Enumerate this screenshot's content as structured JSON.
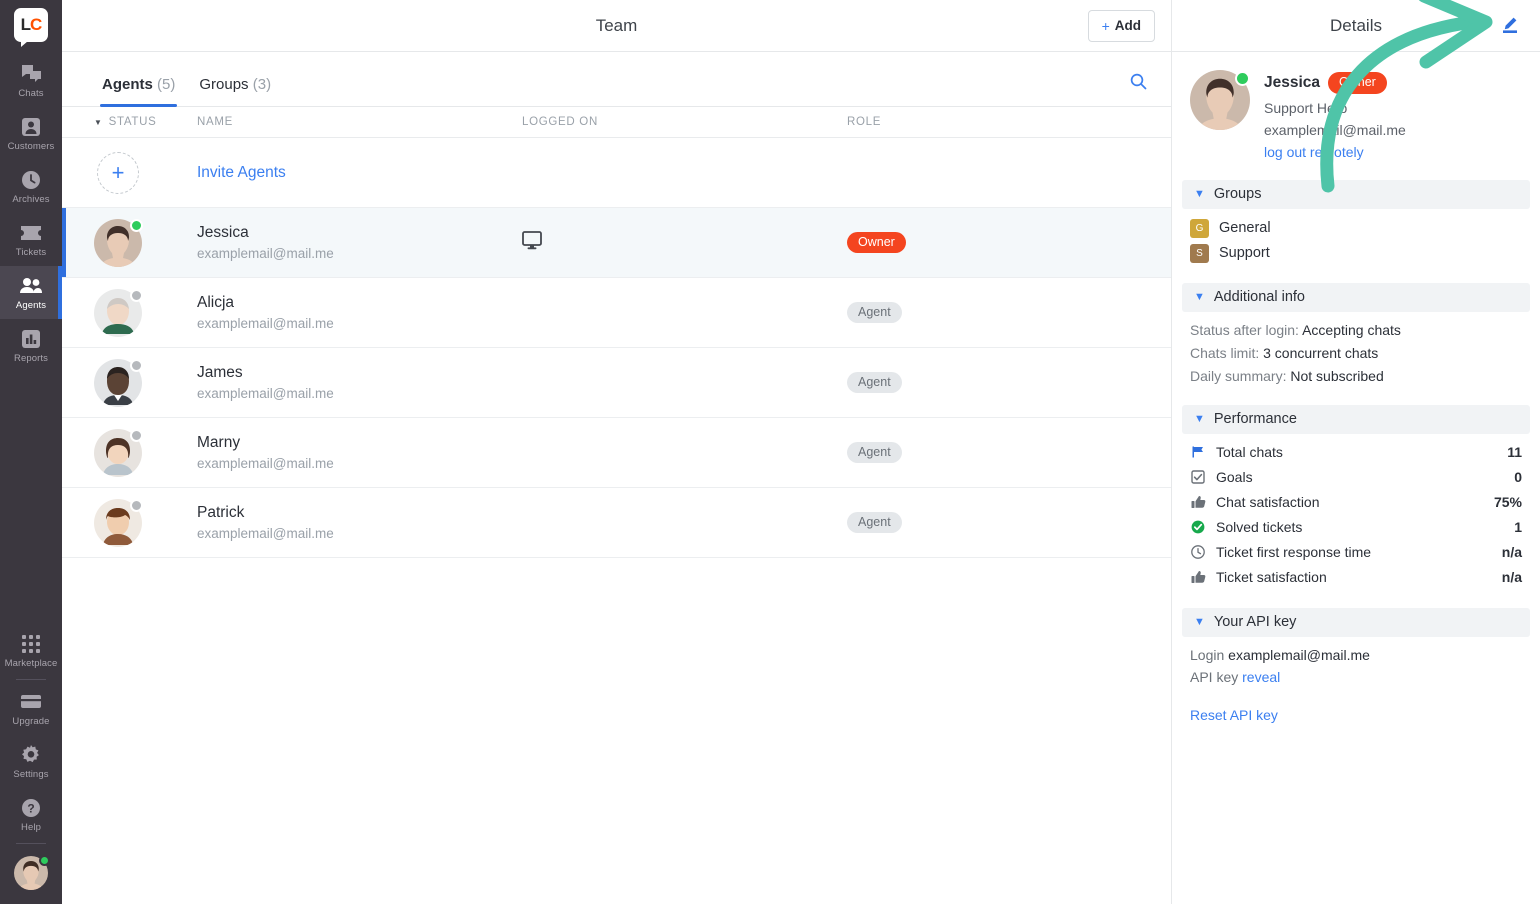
{
  "nav": {
    "logo": {
      "left": "L",
      "right": "C",
      "name": "livechat-logo"
    },
    "items": [
      {
        "label": "Chats",
        "icon": "chats-icon",
        "active": false
      },
      {
        "label": "Customers",
        "icon": "customers-icon",
        "active": false
      },
      {
        "label": "Archives",
        "icon": "archives-icon",
        "active": false
      },
      {
        "label": "Tickets",
        "icon": "tickets-icon",
        "active": false
      },
      {
        "label": "Agents",
        "icon": "agents-icon",
        "active": true
      },
      {
        "label": "Reports",
        "icon": "reports-icon",
        "active": false
      }
    ],
    "bottom_items": [
      {
        "label": "Marketplace",
        "icon": "marketplace-icon"
      },
      {
        "label": "Upgrade",
        "icon": "upgrade-icon"
      },
      {
        "label": "Settings",
        "icon": "gear-icon"
      },
      {
        "label": "Help",
        "icon": "help-icon"
      }
    ],
    "account_status": "online"
  },
  "header": {
    "title": "Team",
    "add_button": {
      "plus": "+",
      "label": "Add"
    }
  },
  "tabs": [
    {
      "label": "Agents",
      "count": "(5)",
      "active": true
    },
    {
      "label": "Groups",
      "count": "(3)",
      "active": false
    }
  ],
  "search": {
    "icon": "search-icon"
  },
  "table": {
    "columns": {
      "status": "STATUS",
      "name": "NAME",
      "logged_on": "LOGGED ON",
      "role": "ROLE"
    },
    "invite_row": {
      "label": "Invite Agents",
      "plus": "+"
    },
    "rows": [
      {
        "name": "Jessica",
        "email": "examplemail@mail.me",
        "status": "online",
        "logged_on": "desktop-icon",
        "role": "Owner",
        "role_kind": "owner",
        "selected": true
      },
      {
        "name": "Alicja",
        "email": "examplemail@mail.me",
        "status": "offline",
        "logged_on": "",
        "role": "Agent",
        "role_kind": "agent",
        "selected": false
      },
      {
        "name": "James",
        "email": "examplemail@mail.me",
        "status": "offline",
        "logged_on": "",
        "role": "Agent",
        "role_kind": "agent",
        "selected": false
      },
      {
        "name": "Marny",
        "email": "examplemail@mail.me",
        "status": "offline",
        "logged_on": "",
        "role": "Agent",
        "role_kind": "agent",
        "selected": false
      },
      {
        "name": "Patrick",
        "email": "examplemail@mail.me",
        "status": "offline",
        "logged_on": "",
        "role": "Agent",
        "role_kind": "agent",
        "selected": false
      }
    ]
  },
  "details": {
    "title": "Details",
    "edit_icon": "edit-pencil-icon",
    "profile": {
      "name": "Jessica",
      "badge": "Owner",
      "job_title": "Support Hero",
      "email": "examplemail@mail.me",
      "logout_link": "log out remotely",
      "status": "online"
    },
    "groups_section": {
      "title": "Groups",
      "items": [
        {
          "initial": "G",
          "name": "General",
          "color": "#cfa73a"
        },
        {
          "initial": "S",
          "name": "Support",
          "color": "#a07a4e"
        }
      ]
    },
    "additional_info": {
      "title": "Additional info",
      "rows": [
        {
          "key": "Status after login:",
          "value": "Accepting chats"
        },
        {
          "key": "Chats limit:",
          "value": "3 concurrent chats"
        },
        {
          "key": "Daily summary:",
          "value": "Not subscribed"
        }
      ]
    },
    "performance": {
      "title": "Performance",
      "rows": [
        {
          "icon": "flag-icon",
          "label": "Total chats",
          "value": "11"
        },
        {
          "icon": "checkbox-icon",
          "label": "Goals",
          "value": "0"
        },
        {
          "icon": "thumbs-up-icon",
          "label": "Chat satisfaction",
          "value": "75%"
        },
        {
          "icon": "check-circle-icon",
          "label": "Solved tickets",
          "value": "1"
        },
        {
          "icon": "clock-icon",
          "label": "Ticket first response time",
          "value": "n/a"
        },
        {
          "icon": "thumbs-up-icon",
          "label": "Ticket satisfaction",
          "value": "n/a"
        }
      ]
    },
    "api_key": {
      "title": "Your API key",
      "login_label": "Login",
      "login_value": "examplemail@mail.me",
      "api_key_label": "API key",
      "reveal_link": "reveal",
      "reset_link": "Reset API key"
    }
  },
  "annotation": {
    "type": "curved-arrow",
    "color": "#4fc4a8",
    "points_to": "edit-pencil-icon"
  },
  "colors": {
    "accent_blue": "#2f6fde",
    "link_blue": "#3b7ff0",
    "owner_red": "#f4451f",
    "online_green": "#2ecc5d",
    "offline_gray": "#b6b9bd",
    "nav_bg": "#3b373f",
    "annotation_teal": "#4fc4a8"
  }
}
